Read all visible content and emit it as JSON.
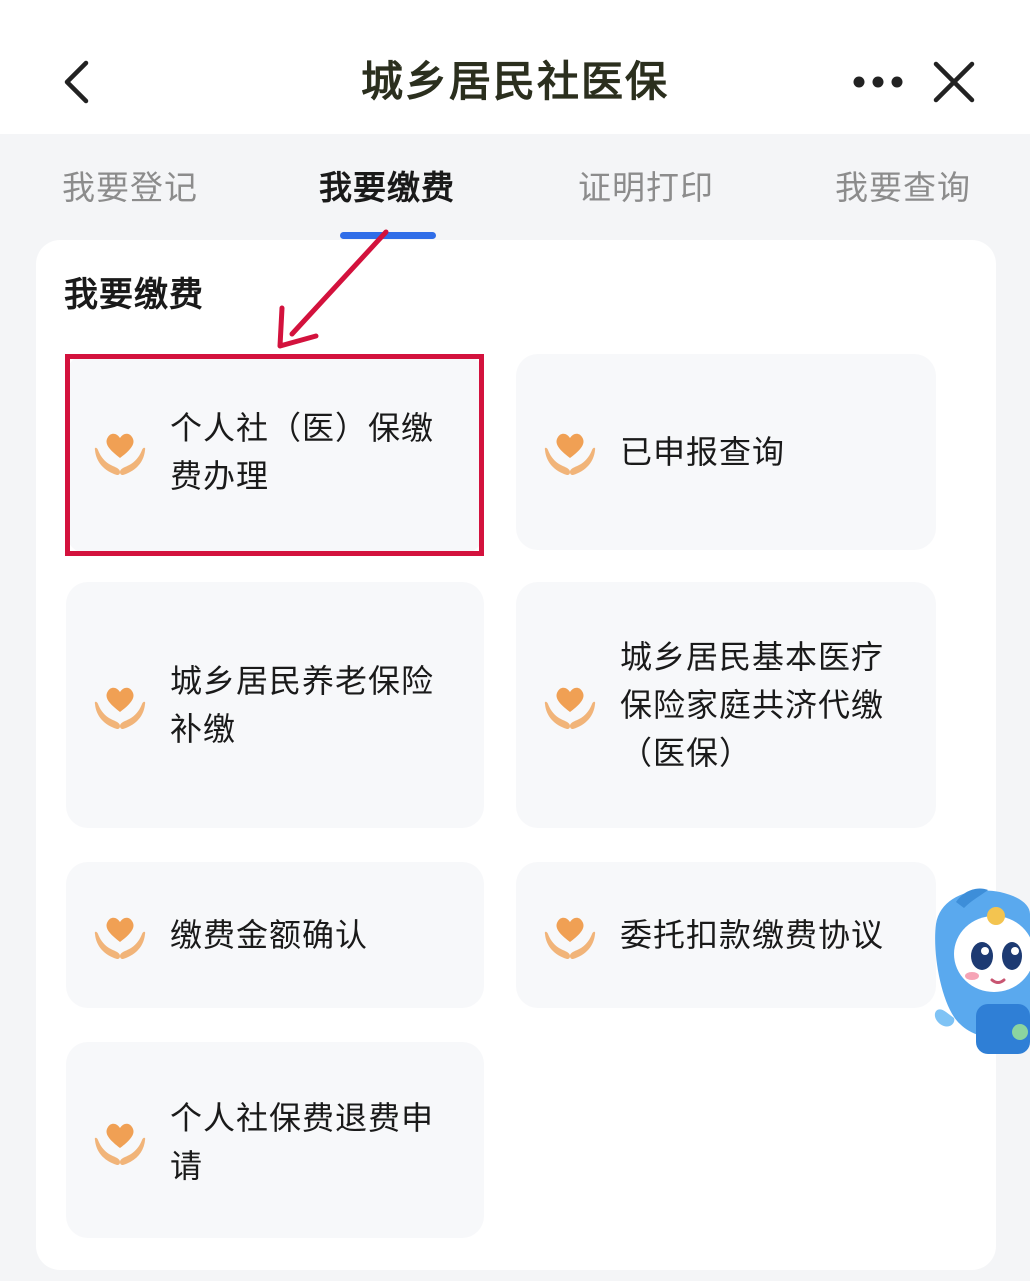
{
  "header": {
    "title": "城乡居民社医保",
    "back_icon": "chevron-left-icon",
    "more_icon": "more-dots-icon",
    "close_icon": "close-icon"
  },
  "tabs": [
    {
      "label": "我要登记",
      "active": false
    },
    {
      "label": "我要缴费",
      "active": true
    },
    {
      "label": "证明打印",
      "active": false
    },
    {
      "label": "我要查询",
      "active": false
    }
  ],
  "section": {
    "title": "我要缴费"
  },
  "services": [
    {
      "label": "个人社（医）保缴费办理",
      "icon": "heart-hands-icon",
      "highlighted": true
    },
    {
      "label": "已申报查询",
      "icon": "heart-hands-icon"
    },
    {
      "label": "城乡居民养老保险补缴",
      "icon": "heart-hands-icon"
    },
    {
      "label": "城乡居民基本医疗保险家庭共济代缴（医保）",
      "icon": "heart-hands-icon"
    },
    {
      "label": "缴费金额确认",
      "icon": "heart-hands-icon"
    },
    {
      "label": "委托扣款缴费协议",
      "icon": "heart-hands-icon"
    },
    {
      "label": "个人社保费退费申请",
      "icon": "heart-hands-icon"
    }
  ],
  "colors": {
    "accent": "#2f6de8",
    "icon_orange": "#f0a054",
    "highlight": "#d3123d",
    "card_bg": "#f7f8fa"
  }
}
